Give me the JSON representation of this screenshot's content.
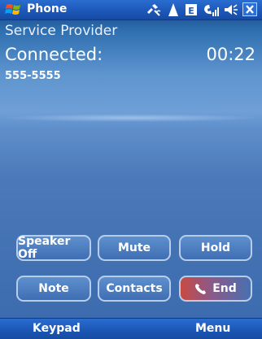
{
  "titlebar": {
    "title": "Phone",
    "icons": [
      "start-logo-icon",
      "connectivity-icon",
      "signal-antenna-icon",
      "edge-data-icon",
      "phone-signal-icon",
      "volume-icon",
      "close-icon"
    ],
    "close_label": "✕"
  },
  "call": {
    "provider": "Service Provider",
    "status": "Connected:",
    "duration": "00:22",
    "number": "555-5555"
  },
  "buttons": {
    "speaker": "Speaker Off",
    "mute": "Mute",
    "hold": "Hold",
    "note": "Note",
    "contacts": "Contacts",
    "end": "End"
  },
  "softkeys": {
    "left": "Keypad",
    "right": "Menu"
  },
  "colors": {
    "titlebar": "#1d58b8",
    "background": "#4a7bbd",
    "end_button": "#c84a43"
  }
}
